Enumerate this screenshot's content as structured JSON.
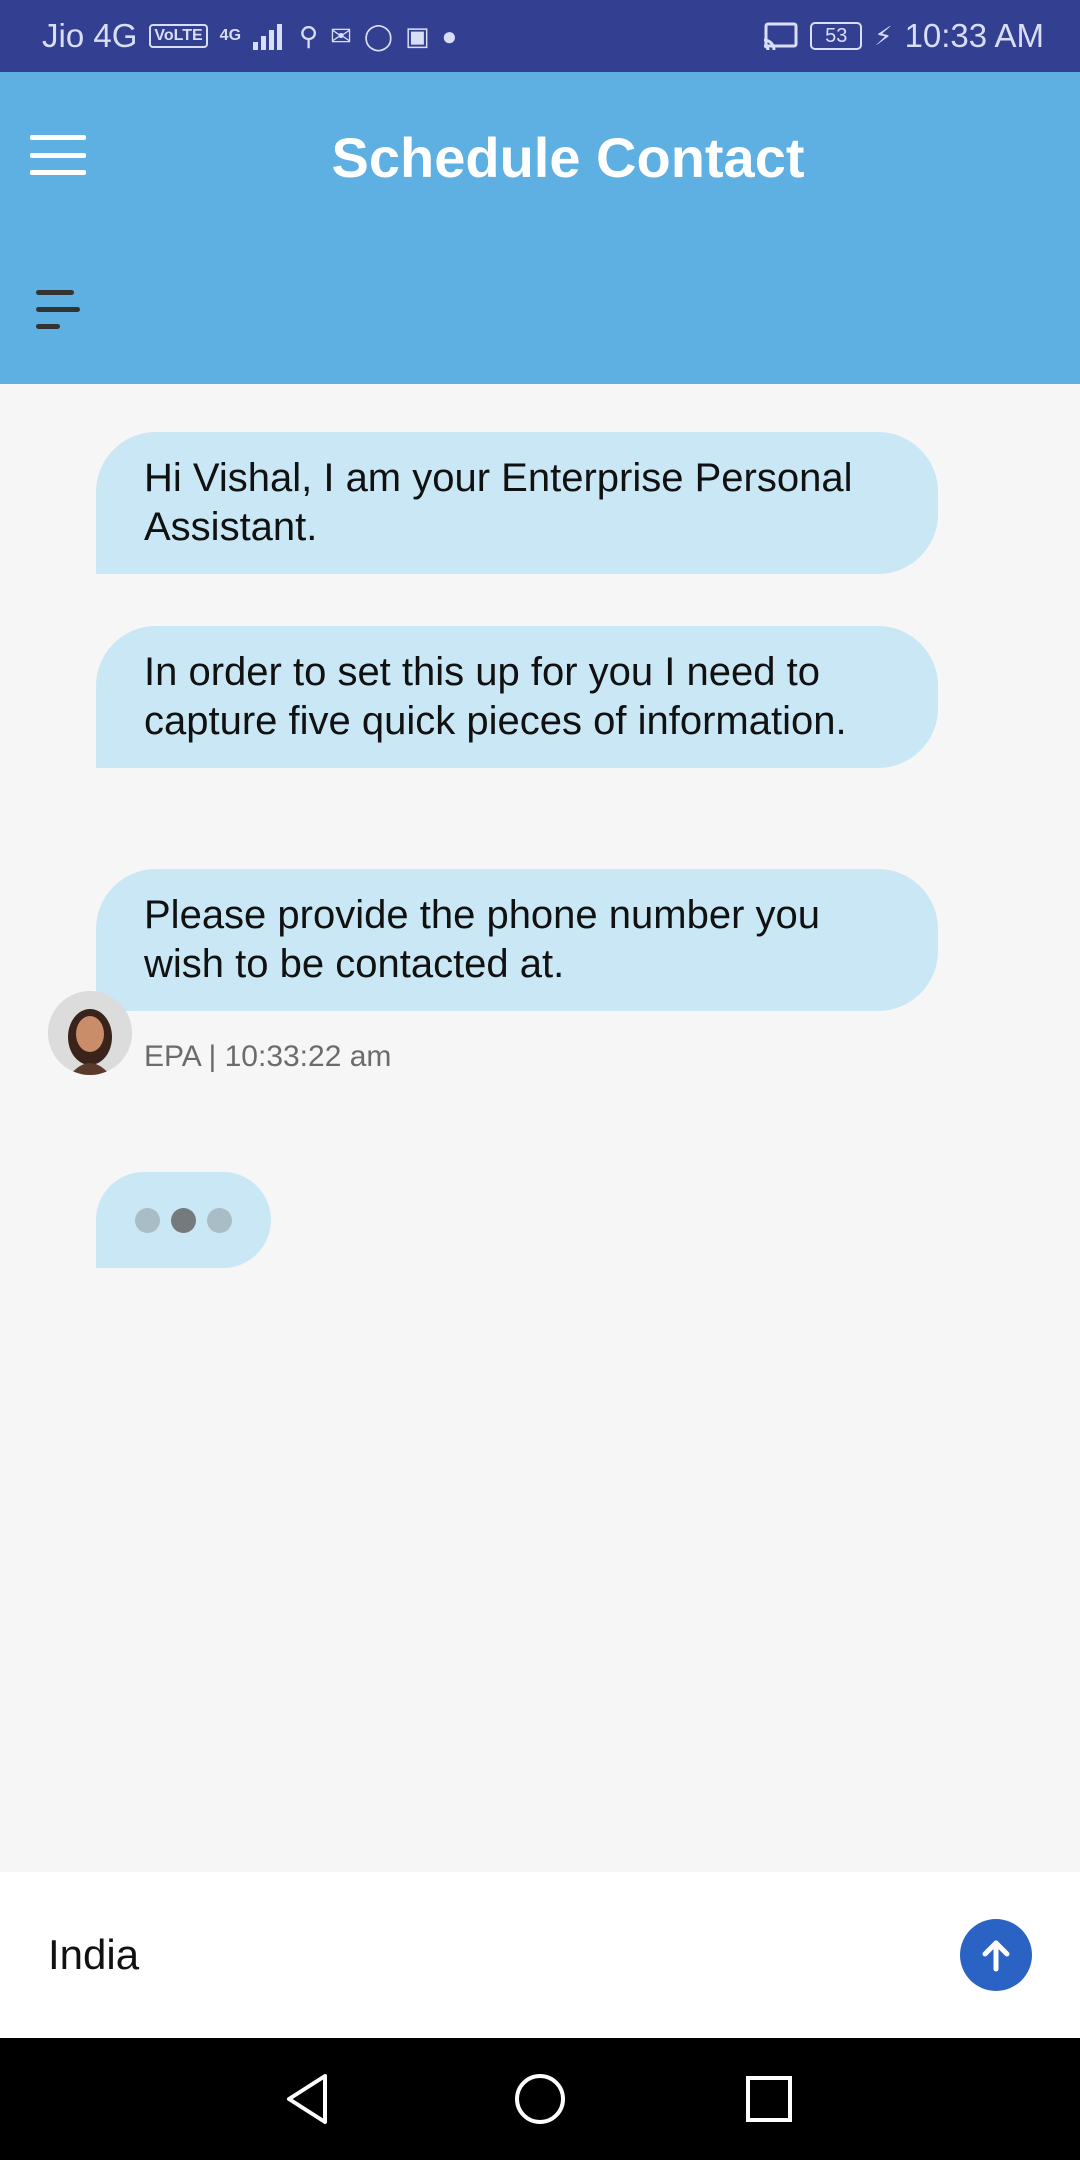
{
  "status_bar": {
    "carrier": "Jio 4G",
    "volte": "VoLTE",
    "network": "4G",
    "battery": "53",
    "time": "10:33 AM"
  },
  "header": {
    "title": "Schedule Contact",
    "menu_icon": "hamburger-icon",
    "secondary_menu_icon": "menu-lines-icon"
  },
  "chat": {
    "messages": [
      {
        "text": "Hi Vishal, I am your Enterprise Personal Assistant."
      },
      {
        "text": "In order to set this up for you I need to capture five quick pieces of information."
      },
      {
        "text": "Please provide the phone number you wish to be contacted at."
      }
    ],
    "meta": "EPA | 10:33:22 am",
    "typing_indicator": true
  },
  "input": {
    "value": "India",
    "send_icon": "arrow-up-icon"
  },
  "colors": {
    "status_bar": "#333f91",
    "header": "#5eb0e2",
    "bubble": "#c9e7f5",
    "send_button": "#2a63c4"
  }
}
